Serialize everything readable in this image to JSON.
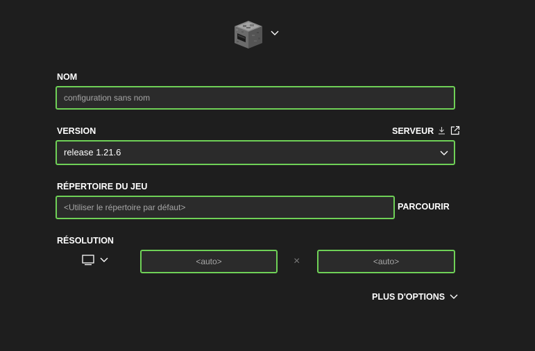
{
  "icon_picker": {
    "icon": "furnace-block-icon",
    "chevron": "chevron-down-icon"
  },
  "name": {
    "label": "NOM",
    "placeholder": "configuration sans nom",
    "value": ""
  },
  "version": {
    "label": "VERSION",
    "server_link": "SERVEUR",
    "server_icons": [
      "download-icon",
      "external-link-icon"
    ],
    "selected": "release 1.21.6"
  },
  "game_dir": {
    "label": "RÉPERTOIRE DU JEU",
    "placeholder": "<Utiliser le répertoire par défaut>",
    "value": "",
    "browse_label": "PARCOURIR"
  },
  "resolution": {
    "label": "RÉSOLUTION",
    "preset_icon": "monitor-icon",
    "width_placeholder": "<auto>",
    "height_placeholder": "<auto>",
    "separator": "×"
  },
  "more_options": {
    "label": "PLUS D'OPTIONS"
  },
  "colors": {
    "background": "#1e1e1e",
    "field_background": "#2b2b2b",
    "accent_border": "#6fd157",
    "placeholder_text": "#a6a6a6"
  }
}
